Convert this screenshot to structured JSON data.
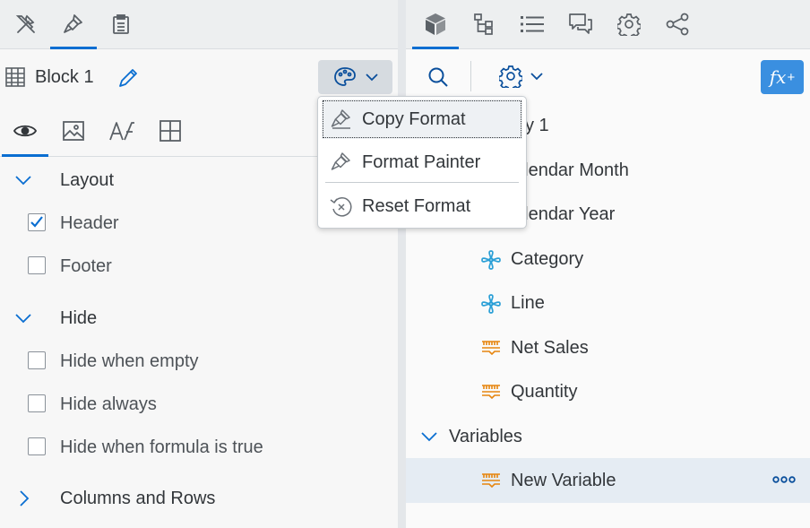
{
  "left": {
    "tabs": [
      {
        "name": "tools-icon"
      },
      {
        "name": "format-brush-icon"
      },
      {
        "name": "clipboard-icon"
      }
    ],
    "block": {
      "title": "Block 1"
    },
    "sections": {
      "layout": {
        "title": "Layout",
        "header_label": "Header",
        "header_checked": true,
        "footer_label": "Footer",
        "footer_checked": false
      },
      "hide": {
        "title": "Hide",
        "when_empty": "Hide when empty",
        "always": "Hide always",
        "formula": "Hide when formula is true"
      },
      "columns_rows": {
        "title": "Columns and Rows"
      }
    }
  },
  "menu": {
    "items": [
      {
        "label": "Copy Format",
        "icon": "copy-format-icon"
      },
      {
        "label": "Format Painter",
        "icon": "format-painter-icon"
      },
      {
        "label": "Reset Format",
        "icon": "reset-format-icon"
      }
    ]
  },
  "right": {
    "tree": {
      "query_label": "y 1",
      "items": [
        {
          "label": "alendar Month"
        },
        {
          "label": "alendar Year"
        },
        {
          "label": "Category",
          "type": "dimension"
        },
        {
          "label": "Line",
          "type": "dimension"
        },
        {
          "label": "Net Sales",
          "type": "measure"
        },
        {
          "label": "Quantity",
          "type": "measure"
        }
      ],
      "variables_label": "Variables",
      "variable_item": "New Variable"
    },
    "fx_label": "fx",
    "fx_sup": "+"
  },
  "colors": {
    "accent": "#0a6ed1",
    "dimension": "#2a9fd6",
    "measure": "#e6850e",
    "fx_button": "#3a8fe0"
  }
}
